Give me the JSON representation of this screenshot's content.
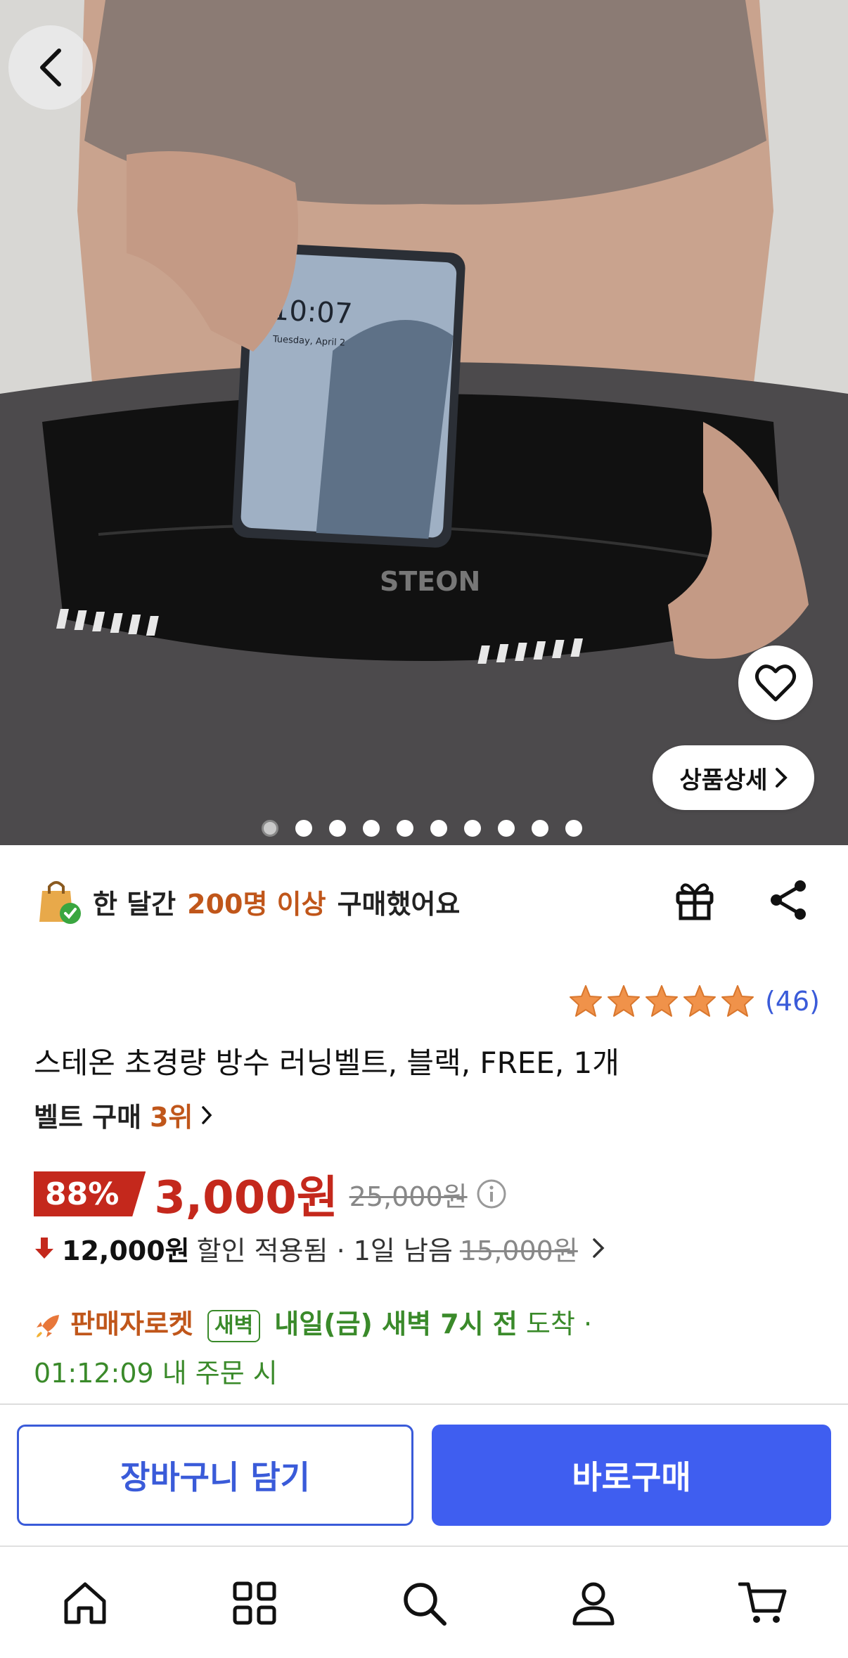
{
  "hero": {
    "brand_print": "STEON",
    "phone_time": "10:07",
    "phone_date": "Tuesday, April 2",
    "detail_label": "상품상세",
    "dots_total": 10,
    "active_dot": 0
  },
  "social": {
    "prefix": "한 달간",
    "highlight": "200명 이상",
    "suffix": "구매했어요"
  },
  "rating": {
    "stars": 5,
    "count": "(46)"
  },
  "product": {
    "title": "스테온 초경량 방수 러닝벨트, 블랙, FREE, 1개",
    "rank_label": "벨트 구매",
    "rank_value": "3위"
  },
  "price": {
    "discount": "88%",
    "sale": "3,000원",
    "original": "25,000원"
  },
  "coupon": {
    "amount": "12,000원",
    "text": "할인 적용됨 · 1일 남음",
    "strike": "15,000원"
  },
  "delivery": {
    "seller": "판매자로켓",
    "tag": "새벽",
    "bold": "내일(금) 새벽 7시 전",
    "rest": "도착 ·",
    "line2": "01:12:09 내 주문 시"
  },
  "actions": {
    "cart": "장바구니 담기",
    "buy": "바로구매"
  },
  "colors": {
    "accent_blue": "#3f5ef0",
    "price_red": "#c4281c",
    "highlight_orange": "#c0561a",
    "delivery_green": "#3a8a2a",
    "star_orange": "#f0924a"
  },
  "tabs": [
    "home-icon",
    "grid-icon",
    "search-icon",
    "user-icon",
    "cart-icon"
  ]
}
